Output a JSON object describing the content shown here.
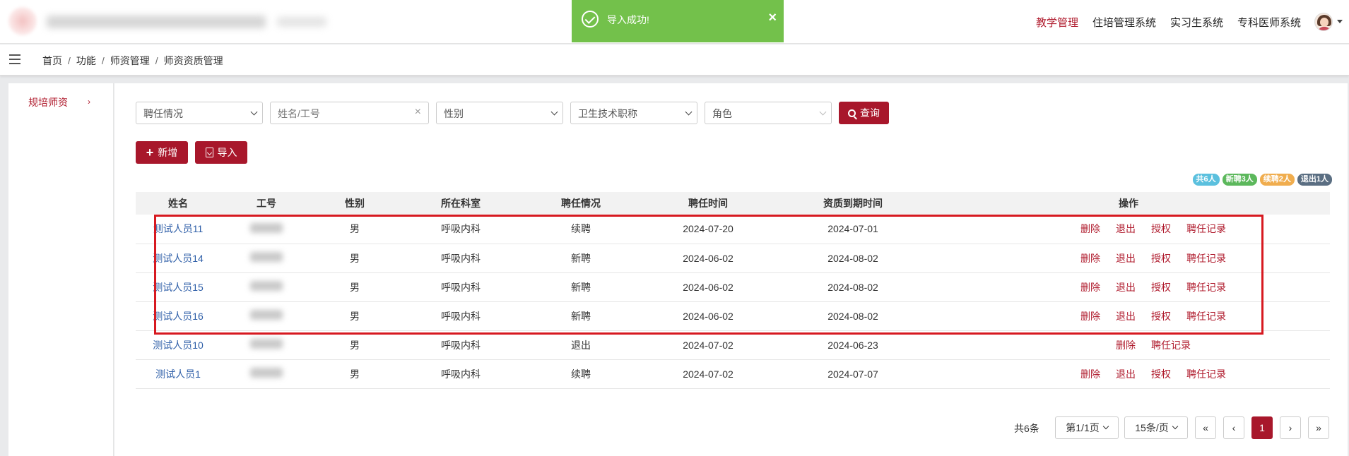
{
  "toast": {
    "message": "导入成功!",
    "close": "×"
  },
  "topnav": {
    "items": [
      "教学管理",
      "住培管理系统",
      "实习生系统",
      "专科医师系统"
    ],
    "active_index": 0
  },
  "breadcrumb": {
    "items": [
      "首页",
      "功能",
      "师资管理",
      "师资资质管理"
    ],
    "separator": "/"
  },
  "sidebar": {
    "items": [
      {
        "label": "规培师资",
        "chevron": "›"
      }
    ]
  },
  "filters": {
    "employment": "聘任情况",
    "name_placeholder": "姓名/工号",
    "clear": "×",
    "gender": "性别",
    "title": "卫生技术职称",
    "role": "角色",
    "query_button": "查询"
  },
  "toolbar": {
    "add_button": "新增",
    "import_button": "导入"
  },
  "stats": [
    {
      "label": "共6人",
      "color": "#5bc0de"
    },
    {
      "label": "新聘3人",
      "color": "#5cb85c"
    },
    {
      "label": "续聘2人",
      "color": "#f0ad4e"
    },
    {
      "label": "退出1人",
      "color": "#5a6e82"
    }
  ],
  "table": {
    "columns": [
      "姓名",
      "工号",
      "性别",
      "所在科室",
      "聘任情况",
      "聘任时间",
      "资质到期时间",
      "操作"
    ],
    "rows": [
      {
        "name": "测试人员11",
        "gender": "男",
        "dept": "呼吸内科",
        "status": "续聘",
        "hire_date": "2024-07-20",
        "expire_date": "2024-07-01",
        "ops": [
          "删除",
          "退出",
          "授权",
          "聘任记录"
        ]
      },
      {
        "name": "测试人员14",
        "gender": "男",
        "dept": "呼吸内科",
        "status": "新聘",
        "hire_date": "2024-06-02",
        "expire_date": "2024-08-02",
        "ops": [
          "删除",
          "退出",
          "授权",
          "聘任记录"
        ]
      },
      {
        "name": "测试人员15",
        "gender": "男",
        "dept": "呼吸内科",
        "status": "新聘",
        "hire_date": "2024-06-02",
        "expire_date": "2024-08-02",
        "ops": [
          "删除",
          "退出",
          "授权",
          "聘任记录"
        ]
      },
      {
        "name": "测试人员16",
        "gender": "男",
        "dept": "呼吸内科",
        "status": "新聘",
        "hire_date": "2024-06-02",
        "expire_date": "2024-08-02",
        "ops": [
          "删除",
          "退出",
          "授权",
          "聘任记录"
        ]
      },
      {
        "name": "测试人员10",
        "gender": "男",
        "dept": "呼吸内科",
        "status": "退出",
        "hire_date": "2024-07-02",
        "expire_date": "2024-06-23",
        "ops": [
          "删除",
          "聘任记录"
        ]
      },
      {
        "name": "测试人员1",
        "gender": "男",
        "dept": "呼吸内科",
        "status": "续聘",
        "hire_date": "2024-07-02",
        "expire_date": "2024-07-07",
        "ops": [
          "删除",
          "退出",
          "授权",
          "聘任记录"
        ]
      }
    ]
  },
  "pager": {
    "total": "共6条",
    "page_select": "第1/1页",
    "size_select": "15条/页",
    "first": "«",
    "prev": "‹",
    "current": "1",
    "next": "›",
    "last": "»"
  }
}
